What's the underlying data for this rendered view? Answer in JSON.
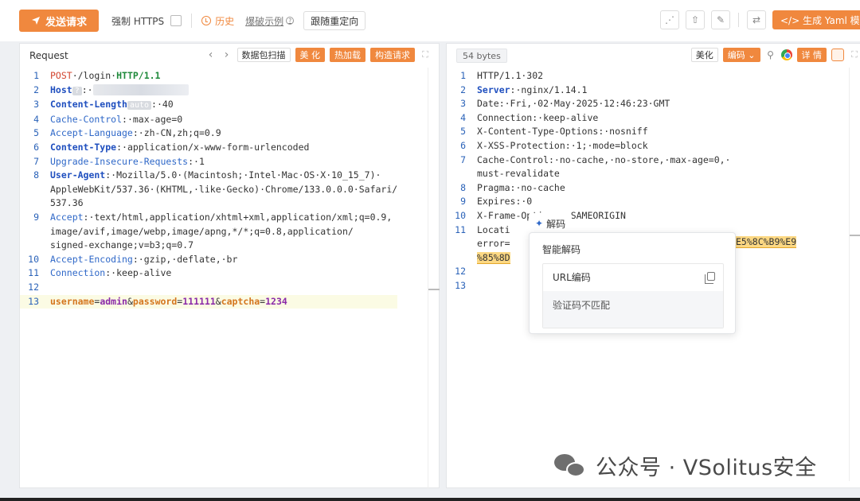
{
  "toolbar": {
    "send_label": "发送请求",
    "https_label": "强制 HTTPS",
    "history_label": "历史",
    "example_label": "爆破示例",
    "redirect_label": "跟随重定向",
    "yaml_label": "</> 生成 Yaml 模板"
  },
  "request": {
    "title": "Request",
    "btn_scan": "数据包扫描",
    "btn_beautify": "美 化",
    "btn_hotload": "热加载",
    "btn_construct": "构造请求",
    "lines": [
      {
        "n": "1",
        "segs": [
          [
            "k-red",
            "POST"
          ],
          [
            "",
            "·/login·"
          ],
          [
            "k-green",
            "HTTP/1.1"
          ]
        ]
      },
      {
        "n": "2",
        "segs": [
          [
            "k-blueb",
            "Host"
          ],
          [
            "badge",
            "?"
          ],
          [
            "",
            ":·"
          ],
          [
            "blur",
            ""
          ]
        ]
      },
      {
        "n": "3",
        "segs": [
          [
            "k-blueb",
            "Content-Length"
          ],
          [
            "badge",
            "auto"
          ],
          [
            "",
            ":·40"
          ]
        ]
      },
      {
        "n": "4",
        "segs": [
          [
            "k-blue",
            "Cache-Control"
          ],
          [
            "",
            ":·max-age=0"
          ]
        ]
      },
      {
        "n": "5",
        "segs": [
          [
            "k-blue",
            "Accept-Language"
          ],
          [
            "",
            ":·zh-CN,zh;q=0.9"
          ]
        ]
      },
      {
        "n": "6",
        "segs": [
          [
            "k-blueb",
            "Content-Type"
          ],
          [
            "",
            ":·application/x-www-form-urlencoded"
          ]
        ]
      },
      {
        "n": "7",
        "segs": [
          [
            "k-blue",
            "Upgrade-Insecure-Requests"
          ],
          [
            "",
            ":·1"
          ]
        ]
      },
      {
        "n": "8",
        "segs": [
          [
            "k-blueb",
            "User-Agent"
          ],
          [
            "",
            ":·Mozilla/5.0·(Macintosh;·Intel·Mac·OS·X·10_15_7)·"
          ]
        ]
      },
      {
        "n": "",
        "segs": [
          [
            "",
            "AppleWebKit/537.36·(KHTML,·like·Gecko)·Chrome/133.0.0.0·Safari/"
          ]
        ]
      },
      {
        "n": "",
        "segs": [
          [
            "",
            "537.36"
          ]
        ]
      },
      {
        "n": "9",
        "segs": [
          [
            "k-blue",
            "Accept"
          ],
          [
            "",
            ":·text/html,application/xhtml+xml,application/xml;q=0.9,"
          ]
        ]
      },
      {
        "n": "",
        "segs": [
          [
            "",
            "image/avif,image/webp,image/apng,*/*;q=0.8,application/"
          ]
        ]
      },
      {
        "n": "",
        "segs": [
          [
            "",
            "signed-exchange;v=b3;q=0.7"
          ]
        ]
      },
      {
        "n": "10",
        "segs": [
          [
            "k-blue",
            "Accept-Encoding"
          ],
          [
            "",
            ":·gzip,·deflate,·br"
          ]
        ]
      },
      {
        "n": "11",
        "segs": [
          [
            "k-blue",
            "Connection"
          ],
          [
            "",
            ":·keep-alive"
          ]
        ]
      },
      {
        "n": "12",
        "segs": []
      },
      {
        "n": "13",
        "hl": true,
        "segs": [
          [
            "k-ora",
            "username"
          ],
          [
            "",
            "="
          ],
          [
            "k-pur",
            "admin"
          ],
          [
            "",
            "&"
          ],
          [
            "k-ora",
            "password"
          ],
          [
            "",
            "="
          ],
          [
            "k-pur",
            "111111"
          ],
          [
            "",
            "&"
          ],
          [
            "k-ora",
            "captcha"
          ],
          [
            "",
            "="
          ],
          [
            "k-pur",
            "1234"
          ]
        ]
      }
    ]
  },
  "response": {
    "bytes": "54 bytes",
    "btn_beautify": "美化",
    "btn_encode": "编码 ⌄",
    "btn_detail": "详 情",
    "lines": [
      {
        "n": "1",
        "segs": [
          [
            "",
            "HTTP/1.1·302"
          ]
        ]
      },
      {
        "n": "2",
        "segs": [
          [
            "k-blueb",
            "Server"
          ],
          [
            "",
            ":·nginx/1.14.1"
          ]
        ]
      },
      {
        "n": "3",
        "segs": [
          [
            "",
            "Date:·Fri,·02·May·2025·12:46:23·GMT"
          ]
        ]
      },
      {
        "n": "4",
        "segs": [
          [
            "",
            "Connection:·keep-alive"
          ]
        ]
      },
      {
        "n": "5",
        "segs": [
          [
            "",
            "X-Content-Type-Options:·nosniff"
          ]
        ]
      },
      {
        "n": "6",
        "segs": [
          [
            "",
            "X-XSS-Protection:·1;·mode=block"
          ]
        ]
      },
      {
        "n": "7",
        "segs": [
          [
            "",
            "Cache-Control:·no-cache,·no-store,·max-age=0,·"
          ]
        ]
      },
      {
        "n": "",
        "segs": [
          [
            "",
            "must-revalidate"
          ]
        ]
      },
      {
        "n": "8",
        "segs": [
          [
            "",
            "Pragma:·no-cache"
          ]
        ]
      },
      {
        "n": "9",
        "segs": [
          [
            "",
            "Expires:·0"
          ]
        ]
      },
      {
        "n": "10",
        "segs": [
          [
            "",
            "X-Frame-Options:·SAMEORIGIN"
          ]
        ]
      },
      {
        "n": "11",
        "segs": [
          [
            "",
            "Locati"
          ],
          [
            "",
            ""
          ]
        ]
      },
      {
        "n": "",
        "segs": [
          [
            "",
            "error="
          ],
          [
            "",
            ""
          ]
        ]
      },
      {
        "n": "",
        "segs": [
          [
            "hl-yellow",
            "%85%8D"
          ]
        ]
      },
      {
        "n": "12",
        "segs": []
      },
      {
        "n": "13",
        "segs": []
      }
    ],
    "loc_tail": "E5%8C%B9%E9"
  },
  "popup": {
    "tab_label": "解码",
    "title": "智能解码",
    "box_label": "URL编码",
    "decoded_value": "验证码不匹配"
  },
  "watermark": {
    "text": "公众号 · VSolitus安全"
  }
}
